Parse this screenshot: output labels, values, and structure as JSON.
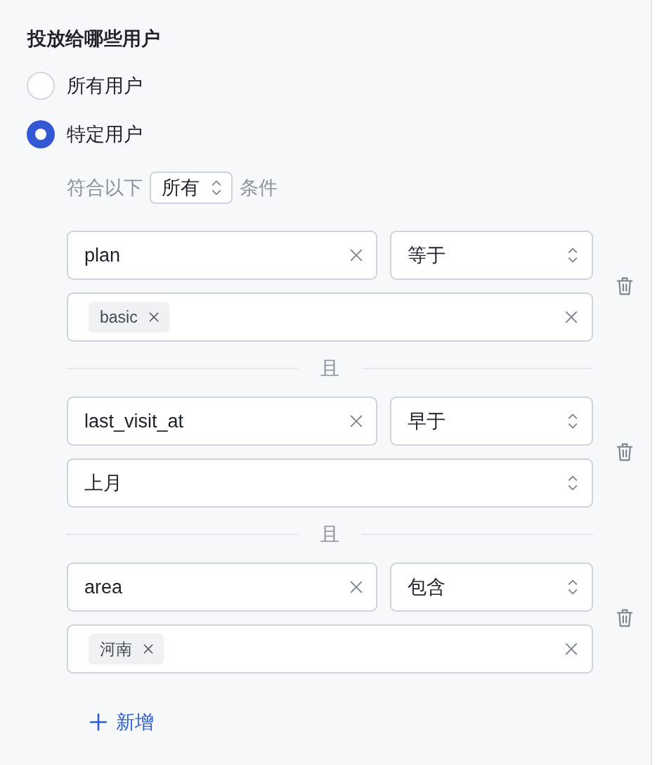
{
  "section": {
    "title": "投放给哪些用户"
  },
  "audience_options": [
    {
      "label": "所有用户",
      "selected": false
    },
    {
      "label": "特定用户",
      "selected": true
    }
  ],
  "match_rule": {
    "prefix": "符合以下",
    "value": "所有",
    "suffix": "条件"
  },
  "conditions": [
    {
      "field": "plan",
      "operator": "等于",
      "kind": "tags",
      "tags": [
        "basic"
      ]
    },
    {
      "joiner": "且",
      "field": "last_visit_at",
      "operator": "早于",
      "kind": "select",
      "value": "上月"
    },
    {
      "joiner": "且",
      "field": "area",
      "operator": "包含",
      "kind": "tags",
      "tags": [
        "河南"
      ]
    }
  ],
  "add_button": {
    "label": "新增"
  }
}
